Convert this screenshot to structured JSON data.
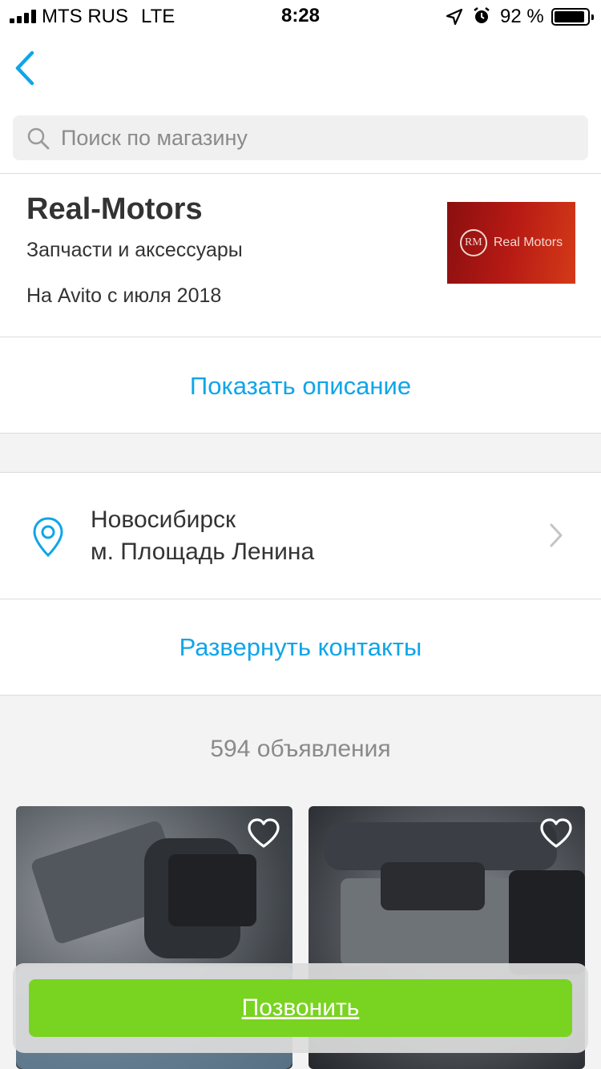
{
  "status_bar": {
    "carrier": "MTS RUS",
    "network": "LTE",
    "time": "8:28",
    "battery_percent": "92 %",
    "battery_level": 0.92
  },
  "search": {
    "placeholder": "Поиск по магазину"
  },
  "shop": {
    "name": "Real-Motors",
    "category": "Запчасти и аксессуары",
    "since": "На Avito с июля 2018",
    "logo_text": "Real Motors",
    "logo_mark": "RM"
  },
  "show_description": "Показать описание",
  "location": {
    "city": "Новосибирск",
    "metro": "м. Площадь Ленина"
  },
  "expand_contacts": "Развернуть контакты",
  "ads_count": "594 объявления",
  "call_button": "Позвонить",
  "colors": {
    "accent": "#0fa5e8",
    "call_green": "#79d321",
    "background_gray": "#f3f3f3"
  }
}
